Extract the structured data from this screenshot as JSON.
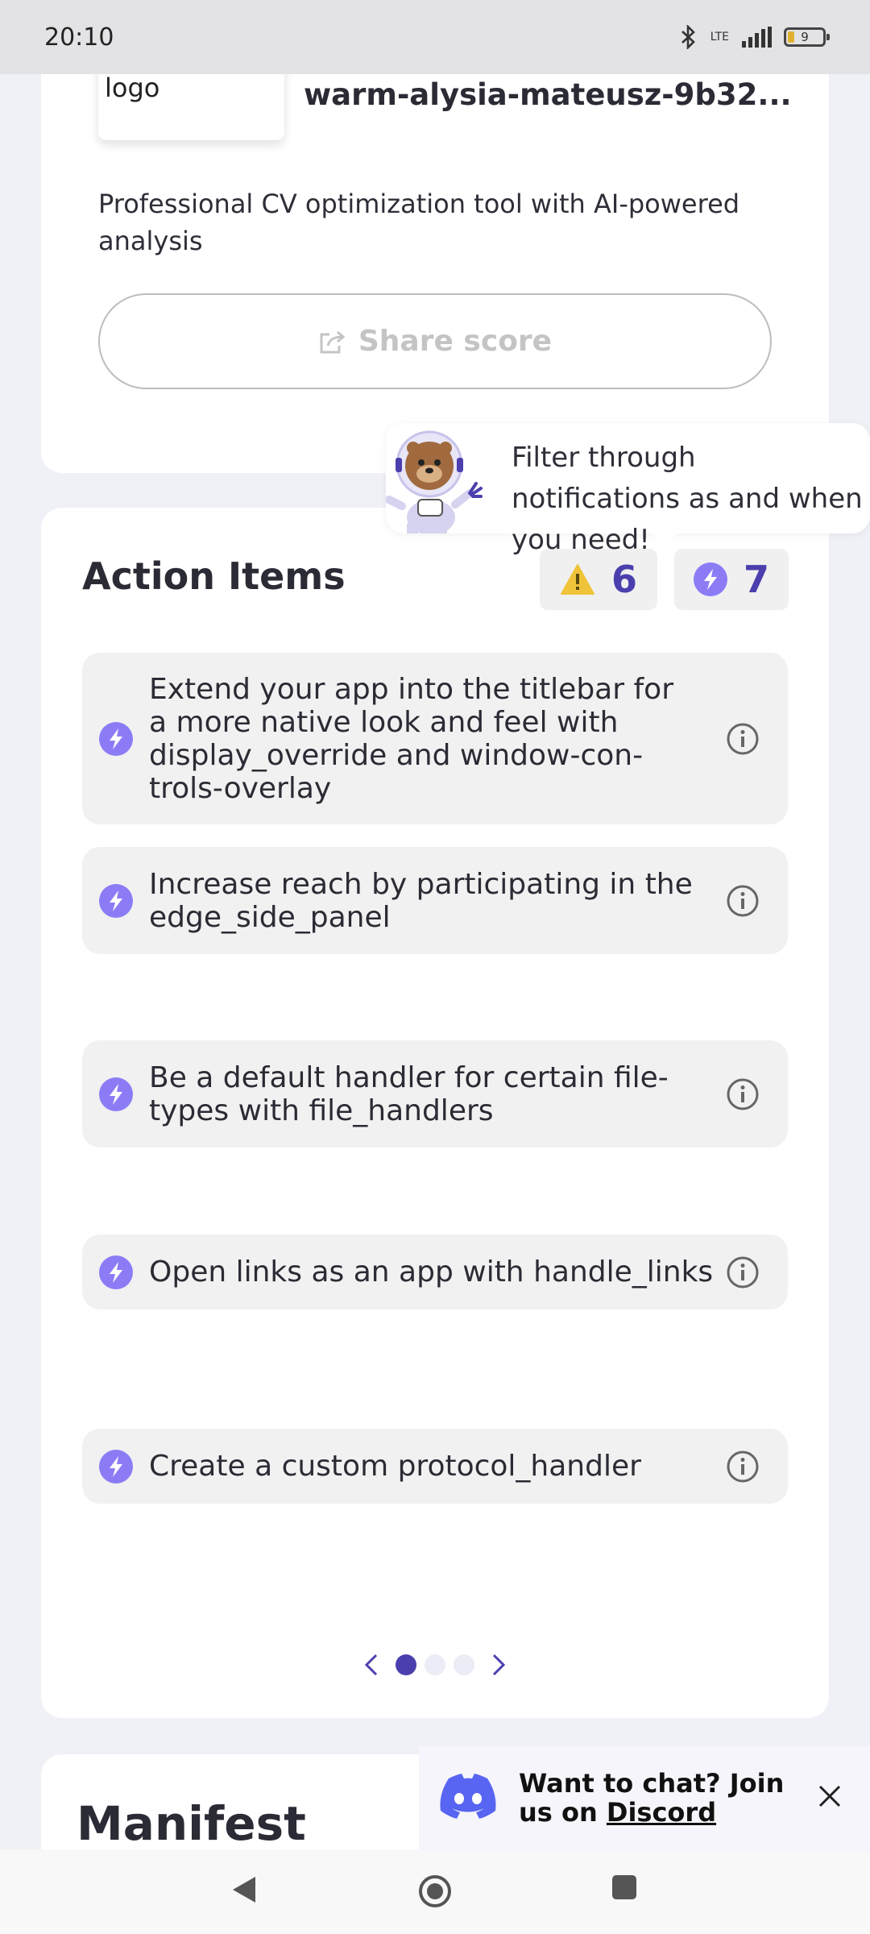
{
  "status_bar": {
    "time": "20:10",
    "network": "LTE",
    "battery": "9"
  },
  "app": {
    "logo_alt": "logo",
    "name": "warm-alysia-mateusz-9b32...",
    "description": "Professional CV optimization tool with AI-powered analysis",
    "share_label": "Share score"
  },
  "tooltip": {
    "text": "Filter through notifications as and when you need!"
  },
  "action_items": {
    "title": "Action Items",
    "warning_count": "6",
    "suggestion_count": "7",
    "items": [
      {
        "text": "Extend your app into the titlebar for a more native look and feel with display_override and window-con-trols-overlay"
      },
      {
        "text": "Increase reach by participating in the edge_side_panel"
      },
      {
        "text": "Be a default handler for certain file-types with file_handlers"
      },
      {
        "text": "Open links as an app with handle_links"
      },
      {
        "text": "Create a custom protocol_handler"
      }
    ]
  },
  "manifest": {
    "title": "Manifest"
  },
  "discord": {
    "line1": "Want to chat? Join",
    "line2_prefix": "us on ",
    "link": "Discord"
  },
  "colors": {
    "accent": "#4b3fae",
    "bolt": "#8b7cf6",
    "warning": "#f0c43a",
    "discord": "#5865f2"
  }
}
